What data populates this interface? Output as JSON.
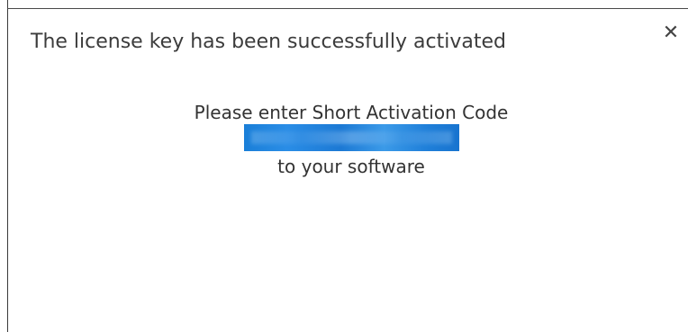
{
  "dialog": {
    "title": "The license key has been successfully activated",
    "close_glyph": "✕",
    "message_line1": "Please enter Short Activation Code",
    "code_value": "",
    "message_line2": "to your software"
  },
  "colors": {
    "code_highlight": "#1c7ed6",
    "text": "#333333"
  },
  "icons": {
    "close": "close-icon"
  }
}
